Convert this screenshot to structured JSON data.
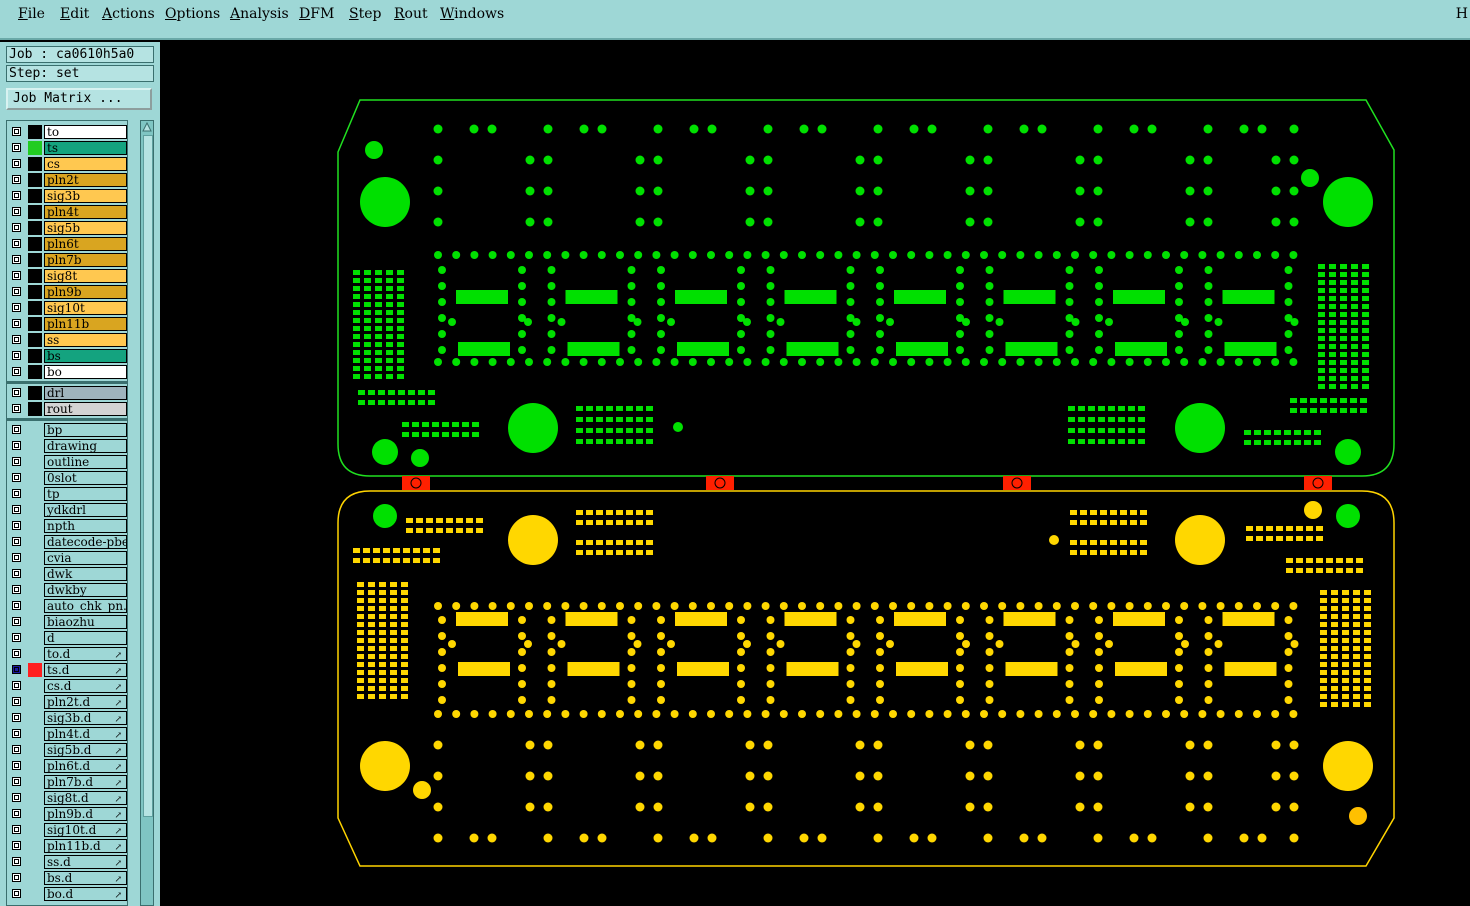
{
  "menu": {
    "items": [
      "File",
      "Edit",
      "Actions",
      "Options",
      "Analysis",
      "DFM",
      "Step",
      "Rout",
      "Windows"
    ],
    "help": "H"
  },
  "panel": {
    "job": "Job : ca0610h5a0",
    "step": "Step: set",
    "job_matrix": "Job Matrix ..."
  },
  "layers": {
    "board": [
      {
        "name": "to",
        "color": "#ffffff",
        "swatch": "#000000"
      },
      {
        "name": "ts",
        "color": "#14a37f",
        "swatch": "#22cc22"
      },
      {
        "name": "cs",
        "color": "#ffc850",
        "swatch": "#000000"
      },
      {
        "name": "pln2t",
        "color": "#d9a520",
        "swatch": "#000000"
      },
      {
        "name": "sig3b",
        "color": "#ffc850",
        "swatch": "#000000"
      },
      {
        "name": "pln4t",
        "color": "#d9a520",
        "swatch": "#000000"
      },
      {
        "name": "sig5b",
        "color": "#ffc850",
        "swatch": "#000000"
      },
      {
        "name": "pln6t",
        "color": "#d9a520",
        "swatch": "#000000"
      },
      {
        "name": "pln7b",
        "color": "#d9a520",
        "swatch": "#000000"
      },
      {
        "name": "sig8t",
        "color": "#ffc850",
        "swatch": "#000000"
      },
      {
        "name": "pln9b",
        "color": "#d9a520",
        "swatch": "#000000"
      },
      {
        "name": "sig10t",
        "color": "#ffc850",
        "swatch": "#000000"
      },
      {
        "name": "pln11b",
        "color": "#d9a520",
        "swatch": "#000000"
      },
      {
        "name": "ss",
        "color": "#ffc850",
        "swatch": "#000000"
      },
      {
        "name": "bs",
        "color": "#14a37f",
        "swatch": "#000000"
      },
      {
        "name": "bo",
        "color": "#ffffff",
        "swatch": "#000000"
      }
    ],
    "drill": [
      {
        "name": "drl",
        "color": "#9fb4bd",
        "swatch": "#000000"
      },
      {
        "name": "rout",
        "color": "#d3d3d3",
        "swatch": "#000000"
      }
    ],
    "misc": [
      {
        "name": "bp",
        "drill": false,
        "selected": false
      },
      {
        "name": "drawing",
        "drill": false,
        "selected": false
      },
      {
        "name": "outline",
        "drill": false,
        "selected": false
      },
      {
        "name": "0slot",
        "drill": false,
        "selected": false
      },
      {
        "name": "tp",
        "drill": false,
        "selected": false
      },
      {
        "name": "ydkdrl",
        "drill": false,
        "selected": false
      },
      {
        "name": "npth",
        "drill": false,
        "selected": false
      },
      {
        "name": "datecode-pbe",
        "drill": false,
        "selected": false
      },
      {
        "name": "cvia",
        "drill": false,
        "selected": false
      },
      {
        "name": "dwk",
        "drill": false,
        "selected": false
      },
      {
        "name": "dwkby",
        "drill": false,
        "selected": false
      },
      {
        "name": "auto_chk_pn.",
        "drill": false,
        "selected": false
      },
      {
        "name": "biaozhu",
        "drill": false,
        "selected": false
      },
      {
        "name": "d",
        "drill": false,
        "selected": false
      },
      {
        "name": "to.d",
        "drill": true,
        "selected": false
      },
      {
        "name": "ts.d",
        "drill": true,
        "selected": true
      },
      {
        "name": "cs.d",
        "drill": true,
        "selected": false
      },
      {
        "name": "pln2t.d",
        "drill": true,
        "selected": false
      },
      {
        "name": "sig3b.d",
        "drill": true,
        "selected": false
      },
      {
        "name": "pln4t.d",
        "drill": true,
        "selected": false
      },
      {
        "name": "sig5b.d",
        "drill": true,
        "selected": false
      },
      {
        "name": "pln6t.d",
        "drill": true,
        "selected": false
      },
      {
        "name": "pln7b.d",
        "drill": true,
        "selected": false
      },
      {
        "name": "sig8t.d",
        "drill": true,
        "selected": false
      },
      {
        "name": "pln9b.d",
        "drill": true,
        "selected": false
      },
      {
        "name": "sig10t.d",
        "drill": true,
        "selected": false
      },
      {
        "name": "pln11b.d",
        "drill": true,
        "selected": false
      },
      {
        "name": "ss.d",
        "drill": true,
        "selected": false
      },
      {
        "name": "bs.d",
        "drill": true,
        "selected": false
      },
      {
        "name": "bo.d",
        "drill": true,
        "selected": false
      }
    ],
    "misc_color": "#9ed7d6"
  },
  "colors": {
    "top_board": "#00e000",
    "bottom_board": "#ffd700",
    "tab": "#ff2000",
    "outline_green": "#20e020",
    "outline_yellow": "#ffd400"
  }
}
